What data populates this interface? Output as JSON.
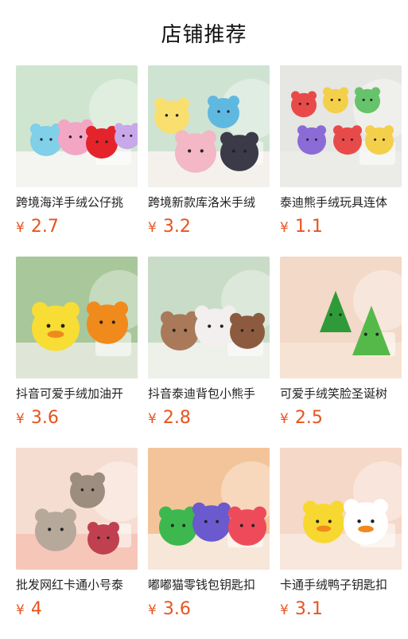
{
  "page": {
    "title": "店铺推荐"
  },
  "colors": {
    "price": "#e8541e"
  },
  "products": [
    {
      "title": "跨境海洋手绒公仔挑",
      "currency": "¥",
      "price": "2.7",
      "image": {
        "bg": "#cfe5cf",
        "floor": "#f4f4f1",
        "accent": [
          "#7fd0e8",
          "#f3a6c4",
          "#e4242a",
          "#c8a8e8"
        ]
      }
    },
    {
      "title": "跨境新款库洛米手绒",
      "currency": "¥",
      "price": "3.2",
      "image": {
        "bg": "#cfe3d3",
        "floor": "#f4f1ec",
        "accent": [
          "#f9df6d",
          "#5fb8e0",
          "#f3b7c5",
          "#3a3a48"
        ]
      }
    },
    {
      "title": "泰迪熊手绒玩具连体",
      "currency": "¥",
      "price": "1.1",
      "image": {
        "bg": "#e6e6e2",
        "floor": "#ebebe7",
        "accent": [
          "#e84a4a",
          "#f4cf4a",
          "#66c26b",
          "#8b6bd6"
        ]
      }
    },
    {
      "title": "抖音可爱手绒加油开",
      "currency": "¥",
      "price": "3.6",
      "image": {
        "bg": "#a8c79a",
        "floor": "#dfe6d8",
        "accent": [
          "#f7dd34",
          "#f08a1c",
          "#e9d09a",
          "#ffffff"
        ]
      }
    },
    {
      "title": "抖音泰迪背包小熊手",
      "currency": "¥",
      "price": "2.8",
      "image": {
        "bg": "#c9dcc7",
        "floor": "#eef0ea",
        "accent": [
          "#a9795a",
          "#f2efee",
          "#8c5b3f",
          "#f29ab3"
        ]
      }
    },
    {
      "title": "可爱手绒笑脸圣诞树",
      "currency": "¥",
      "price": "2.5",
      "image": {
        "bg": "#f3d9c8",
        "floor": "#f7e3d4",
        "accent": [
          "#2f9a38",
          "#55b94a",
          "#f3c9cf",
          "#fbe7d6"
        ]
      }
    },
    {
      "title": "批发网红卡通小号泰",
      "currency": "¥",
      "price": "4",
      "image": {
        "bg": "#f6ddd1",
        "floor": "#f6c7b9",
        "accent": [
          "#9d8d80",
          "#b6a89a",
          "#c04050",
          "#efe6dc"
        ]
      }
    },
    {
      "title": "嘟嘟猫零钱包钥匙扣",
      "currency": "¥",
      "price": "3.6",
      "image": {
        "bg": "#f3c49a",
        "floor": "#f7e7d8",
        "accent": [
          "#3db84f",
          "#6a5acd",
          "#ee4b5a",
          "#ffffff"
        ]
      }
    },
    {
      "title": "卡通手绒鸭子钥匙扣",
      "currency": "¥",
      "price": "3.1",
      "image": {
        "bg": "#f6d8c8",
        "floor": "#f8e7dc",
        "accent": [
          "#f7d830",
          "#ffffff",
          "#3a7fd6",
          "#f08a1c"
        ]
      }
    }
  ]
}
